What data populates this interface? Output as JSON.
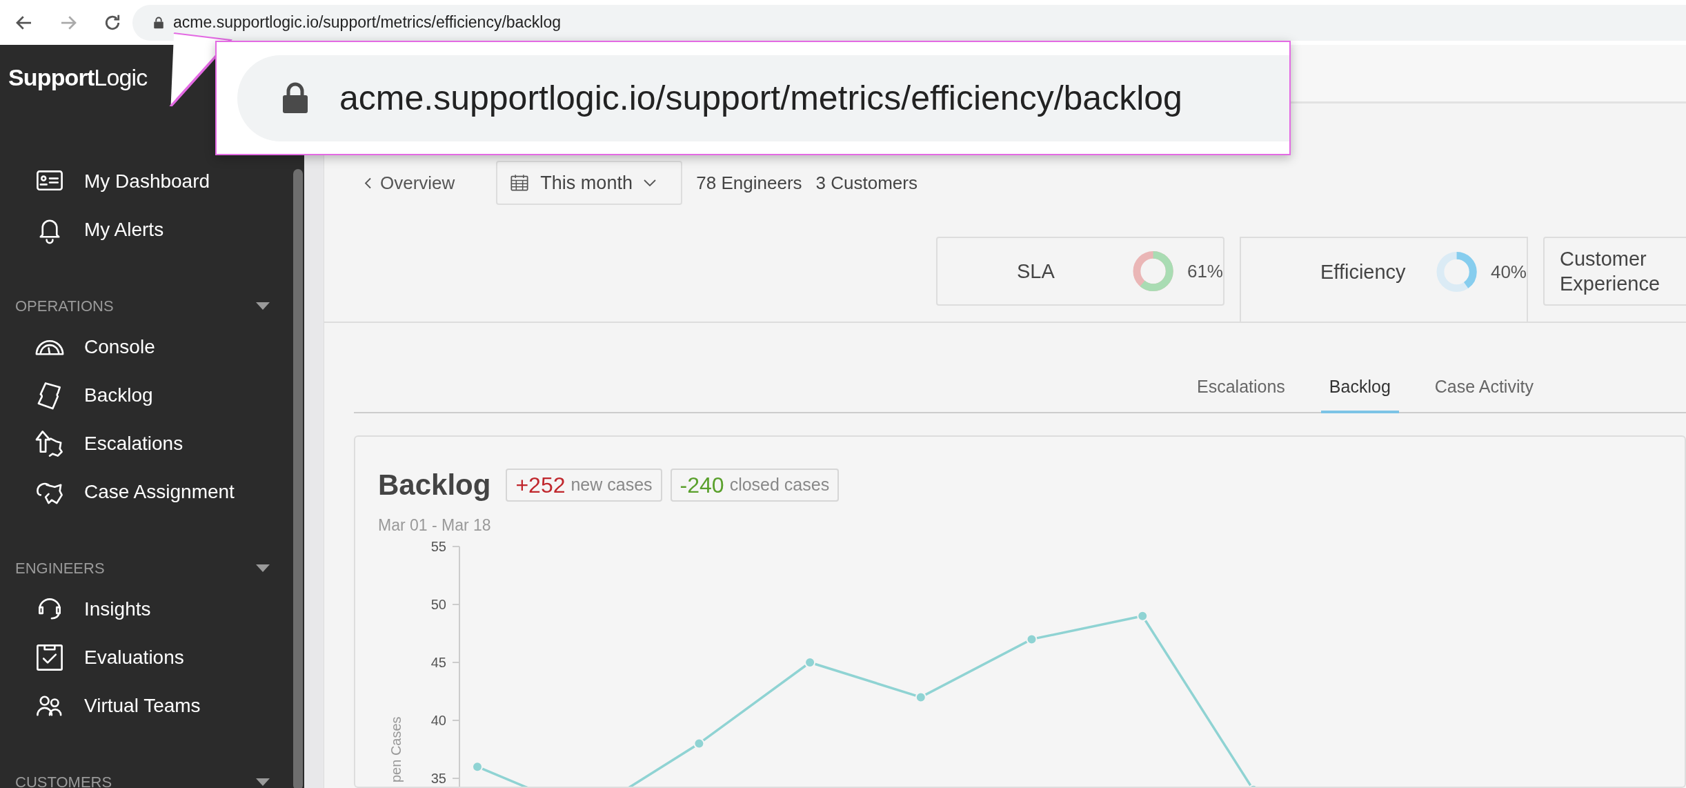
{
  "browser": {
    "url": "acme.supportlogic.io/support/metrics/efficiency/backlog"
  },
  "callout": {
    "url": "acme.supportlogic.io/support/metrics/efficiency/backlog"
  },
  "sidebar": {
    "logo": {
      "bold": "Support",
      "light": "Logic"
    },
    "sections": [
      {
        "items": [
          {
            "label": "My Dashboard"
          },
          {
            "label": "My Alerts"
          }
        ]
      },
      {
        "title": "OPERATIONS",
        "items": [
          {
            "label": "Console"
          },
          {
            "label": "Backlog"
          },
          {
            "label": "Escalations"
          },
          {
            "label": "Case Assignment"
          }
        ]
      },
      {
        "title": "ENGINEERS",
        "items": [
          {
            "label": "Insights"
          },
          {
            "label": "Evaluations"
          },
          {
            "label": "Virtual Teams"
          }
        ]
      },
      {
        "title": "CUSTOMERS"
      }
    ]
  },
  "toolbar": {
    "back_link": "Overview",
    "period": "This month",
    "counts": [
      "78 Engineers",
      "3 Customers"
    ]
  },
  "metric_tabs": [
    {
      "label": "SLA",
      "value": "61%",
      "level": 0.61,
      "selected": false
    },
    {
      "label": "Efficiency",
      "value": "40%",
      "level": 0.4,
      "selected": true
    },
    {
      "label": "Customer Experience",
      "selected": false
    }
  ],
  "sub_tabs": [
    {
      "label": "Escalations",
      "selected": false
    },
    {
      "label": "Backlog",
      "selected": true
    },
    {
      "label": "Case Activity",
      "selected": false
    }
  ],
  "card": {
    "title": "Backlog",
    "badges": [
      {
        "kind": "new",
        "count": "+252",
        "label": "new cases"
      },
      {
        "kind": "closed",
        "count": "-240",
        "label": "closed cases"
      }
    ],
    "date_range": "Mar 01 - Mar 18",
    "chart_data": {
      "type": "line",
      "ylabel": "pen Cases",
      "ylim": [
        25,
        55
      ],
      "yticks": [
        35,
        40,
        45,
        50,
        55
      ],
      "series": [
        {
          "color": "#8fd3d3",
          "marker": "o",
          "values": [
            36,
            32,
            38,
            45,
            42,
            47,
            49,
            34
          ]
        }
      ]
    }
  }
}
